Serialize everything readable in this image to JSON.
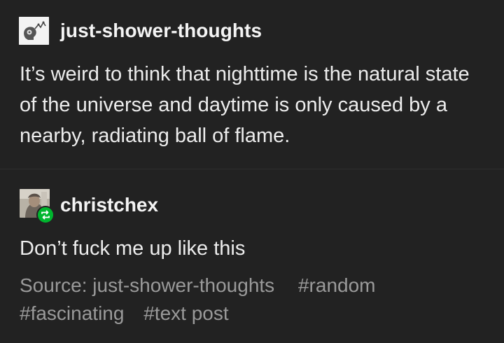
{
  "original_post": {
    "username": "just-shower-thoughts",
    "avatar_icon": "lightbulb-head-icon",
    "text": "It’s weird to think that nighttime is the natural state of the universe and daytime is only caused by a nearby, radiating ball of flame."
  },
  "reblog": {
    "username": "christchex",
    "avatar_icon": "user-photo-avatar",
    "badge_icon": "reblog-icon",
    "text": "Don’t fuck me up like this"
  },
  "footer": {
    "source": "Source: just-shower-thoughts",
    "tags": [
      "#random",
      "#fascinating",
      "#text post"
    ]
  },
  "colors": {
    "background": "#222222",
    "text": "#ededed",
    "muted": "#9a9a9a",
    "reblog_badge": "#00b62e",
    "divider": "#2f2f2f"
  }
}
